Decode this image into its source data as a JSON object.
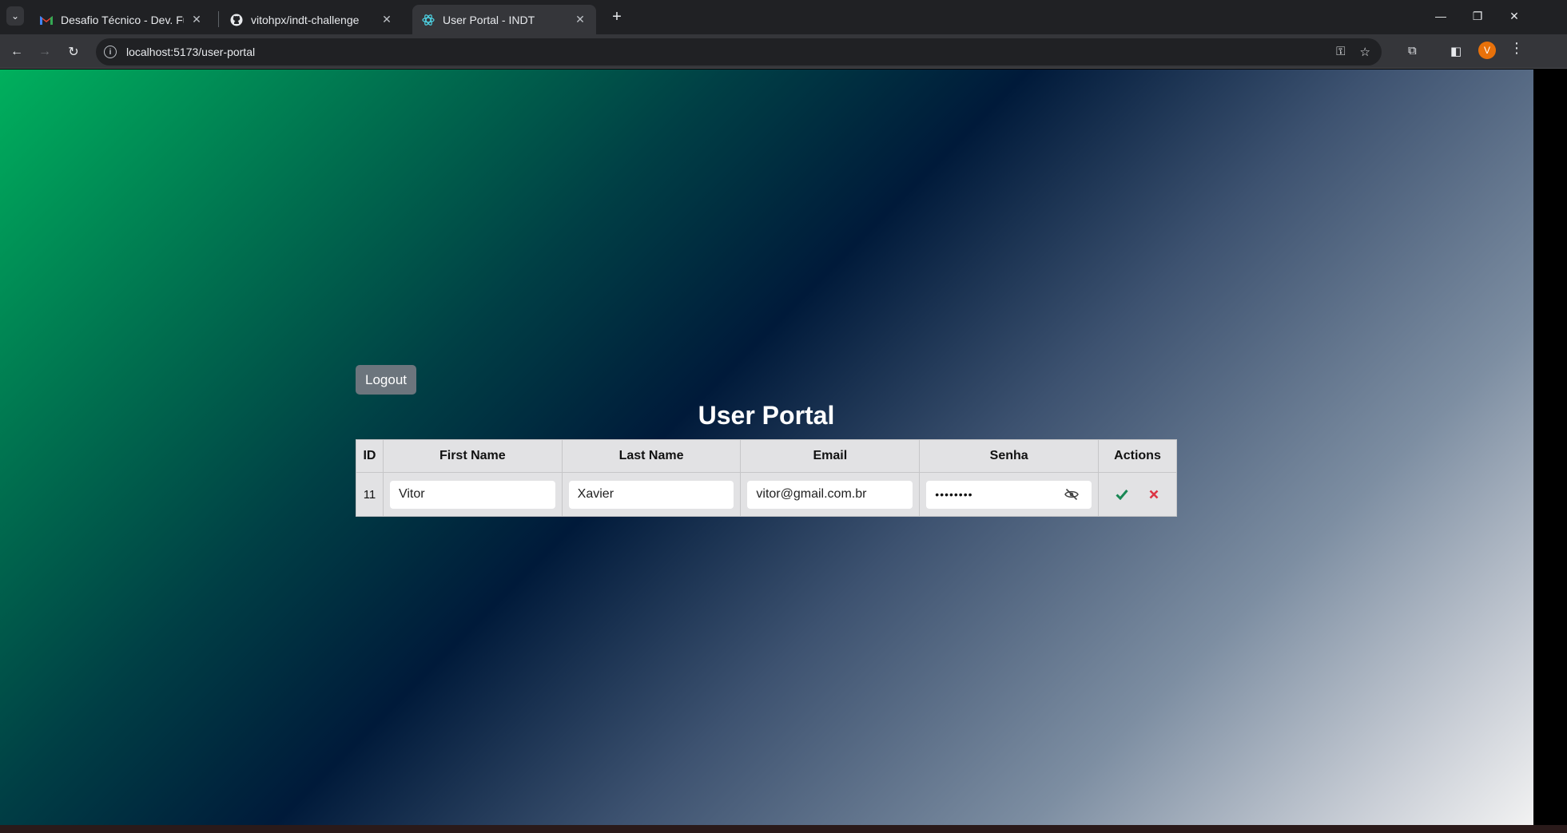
{
  "browser": {
    "tabs": [
      {
        "title": "Desafio Técnico - Dev. Full Stack",
        "favicon": "gmail-icon",
        "active": false
      },
      {
        "title": "vitohpx/indt-challenge",
        "favicon": "github-icon",
        "active": false
      },
      {
        "title": "User Portal - INDT",
        "favicon": "react-icon",
        "active": true
      }
    ],
    "url": "localhost:5173/user-portal",
    "profile_initial": "V",
    "profile_color": "#e8710a"
  },
  "page": {
    "logout_label": "Logout",
    "title": "User Portal",
    "table": {
      "headers": [
        "ID",
        "First Name",
        "Last Name",
        "Email",
        "Senha",
        "Actions"
      ],
      "rows": [
        {
          "id": "11",
          "first_name": "Vitor",
          "last_name": "Xavier",
          "email": "vitor@gmail.com.br",
          "password_masked": "••••••••"
        }
      ]
    },
    "colors": {
      "confirm": "#198754",
      "cancel": "#dc3545",
      "logout_bg": "#6c757d"
    }
  }
}
